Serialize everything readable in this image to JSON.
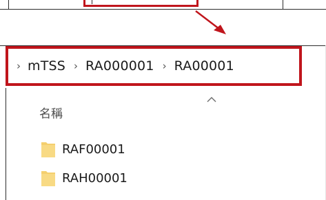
{
  "breadcrumb": {
    "items": [
      "mTSS",
      "RA000001",
      "RA00001"
    ],
    "separator": "›"
  },
  "file_list": {
    "column_header": "名稱",
    "items": [
      {
        "name": "RAF00001",
        "icon": "folder-icon"
      },
      {
        "name": "RAH00001",
        "icon": "folder-icon"
      }
    ]
  },
  "annotation": {
    "highlight_color": "#c0151c",
    "folder_color": "#f4cf6e"
  }
}
